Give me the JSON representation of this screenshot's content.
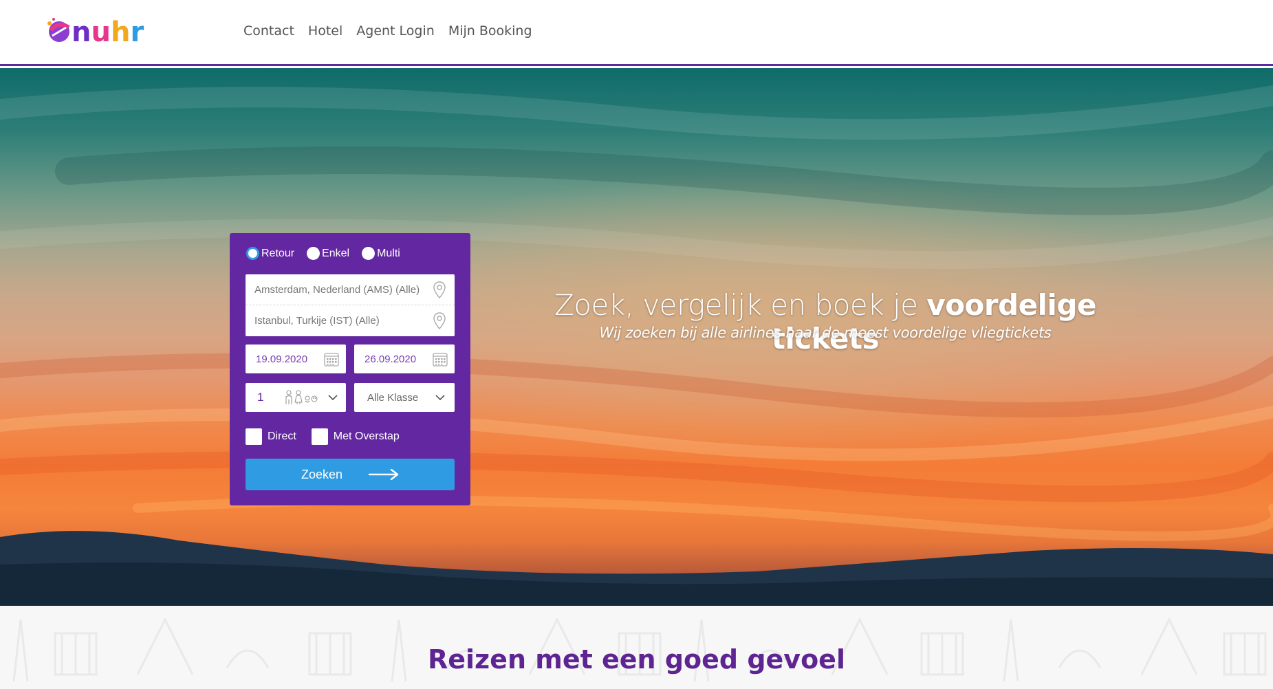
{
  "brand": {
    "logo_text": "nuhr",
    "accent": "#5e2a9e"
  },
  "nav": {
    "items": [
      {
        "label": "Contact"
      },
      {
        "label": "Hotel"
      },
      {
        "label": "Agent Login"
      },
      {
        "label": "Mijn Booking"
      }
    ]
  },
  "search": {
    "trip_types": [
      {
        "label": "Retour",
        "selected": true
      },
      {
        "label": "Enkel",
        "selected": false
      },
      {
        "label": "Multi",
        "selected": false
      }
    ],
    "from": "Amsterdam, Nederland (AMS) (Alle)",
    "to": "Istanbul, Turkije (IST) (Alle)",
    "departure_date": "19.09.2020",
    "return_date": "26.09.2020",
    "passengers": "1",
    "cabin_class": "Alle Klasse",
    "options": [
      {
        "label": "Direct",
        "checked": false
      },
      {
        "label": "Met Overstap",
        "checked": false
      }
    ],
    "button_label": "Zoeken",
    "panel_color": "#6427a2",
    "button_color": "#2e9be3"
  },
  "hero": {
    "title_light": "Zoek, vergelijk en boek je ",
    "title_bold": "voordelige tickets",
    "subtitle": "Wij zoeken bij alle airlines naar de meest voordelige vliegtickets"
  },
  "section": {
    "title": "Reizen met een goed gevoel"
  },
  "icons": {
    "pin": "location-pin-icon",
    "calendar": "calendar-icon",
    "passengers": "passengers-icon",
    "chevron": "chevron-down-icon",
    "arrow": "arrow-right-icon"
  }
}
